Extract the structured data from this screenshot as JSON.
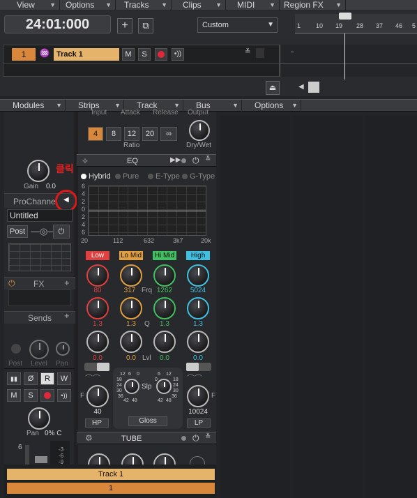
{
  "menu": {
    "view": "View",
    "options": "Options",
    "tracks": "Tracks",
    "clips": "Clips",
    "midi": "MIDI",
    "region_fx": "Region FX"
  },
  "transport": {
    "time": "24:01:000",
    "snap": "Custom",
    "ruler_ticks": [
      "1",
      "10",
      "19",
      "28",
      "37",
      "46",
      "5"
    ]
  },
  "track": {
    "number": "1",
    "name": "Track 1",
    "mute": "M",
    "solo": "S"
  },
  "console_menu": {
    "modules": "Modules",
    "strips": "Strips",
    "track": "Track",
    "bus": "Bus",
    "options": "Options"
  },
  "strip": {
    "gain_label": "Gain",
    "gain_value": "0.0",
    "prochannel_label": "ProChannel",
    "preset": "Untitled",
    "post": "Post",
    "fx_label": "FX",
    "sends_label": "Sends",
    "sends_post": "Post",
    "sends_level": "Level",
    "sends_pan": "Pan",
    "read": "R",
    "write": "W",
    "mute": "M",
    "solo": "S",
    "pan_label": "Pan",
    "pan_value": "0% C",
    "meter_ticks": [
      "6",
      "-3",
      "-6",
      "-9"
    ],
    "annotation": "클릭"
  },
  "compressor": {
    "header_labels": [
      "Input",
      "Attack",
      "Release",
      "Output"
    ],
    "ratios": [
      "4",
      "8",
      "12",
      "20",
      "∞"
    ],
    "ratio_label": "Ratio",
    "drywet_label": "Dry/Wet"
  },
  "eq": {
    "title": "EQ",
    "modes": [
      "Hybrid",
      "Pure",
      "E-Type",
      "G-Type"
    ],
    "y_ticks": [
      "6",
      "4",
      "2",
      "0",
      "2",
      "4",
      "6"
    ],
    "x_ticks": [
      "20",
      "112",
      "632",
      "3k7",
      "20k"
    ],
    "bands": [
      {
        "name": "Low",
        "color": "#e04040",
        "freq": "80",
        "q": "1.3",
        "lvl": "0.0"
      },
      {
        "name": "Lo Mid",
        "color": "#e0a040",
        "freq": "317",
        "q": "1.3",
        "lvl": "0.0"
      },
      {
        "name": "Hi Mid",
        "color": "#40c060",
        "freq": "1262",
        "q": "1.3",
        "lvl": "0.0"
      },
      {
        "name": "High",
        "color": "#40c0e0",
        "freq": "5024",
        "q": "1.3",
        "lvl": "0.0"
      }
    ],
    "frq_label": "Frq",
    "q_label": "Q",
    "lvl_label": "Lvl",
    "hp_value": "40",
    "hp_label": "HP",
    "lp_value": "10024",
    "lp_label": "LP",
    "slp_label": "Slp",
    "gloss_label": "Gloss",
    "f_label": "F",
    "slope_ticks_left": [
      "12",
      "6",
      "0",
      "18",
      "24",
      "30",
      "36",
      "42",
      "48"
    ],
    "slope_ticks_right": [
      "6",
      "12",
      "0",
      "18",
      "24",
      "30",
      "36",
      "42",
      "48"
    ]
  },
  "tube": {
    "title": "TUBE"
  },
  "bottom": {
    "track_name": "Track 1",
    "track_number": "1"
  }
}
